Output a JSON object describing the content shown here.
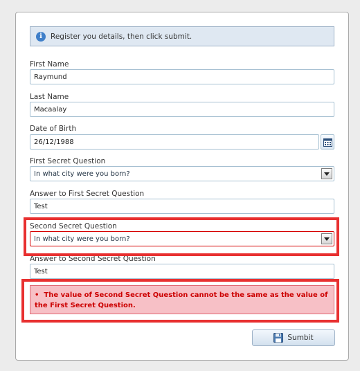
{
  "info": {
    "text": "Register you details, then click submit."
  },
  "form": {
    "first_name": {
      "label": "First Name",
      "value": "Raymund"
    },
    "last_name": {
      "label": "Last Name",
      "value": "Macaalay"
    },
    "dob": {
      "label": "Date of Birth",
      "value": "26/12/1988"
    },
    "q1": {
      "label": "First Secret Question",
      "value": "In what city were you born?"
    },
    "a1": {
      "label": "Answer to First Secret Question",
      "value": "Test"
    },
    "q2": {
      "label": "Second Secret Question",
      "value": "In what city were you born?"
    },
    "a2": {
      "label": "Answer to Second Secret Question",
      "value": "Test"
    }
  },
  "error": {
    "bullet": "•",
    "message": "The value of Second Secret Question cannot be the same as the value of the First Secret Question."
  },
  "submit": {
    "label": "Sumbit"
  },
  "colors": {
    "error_red": "#cc0000",
    "highlight_red": "#e83030",
    "info_bg": "#dfe8f2"
  }
}
